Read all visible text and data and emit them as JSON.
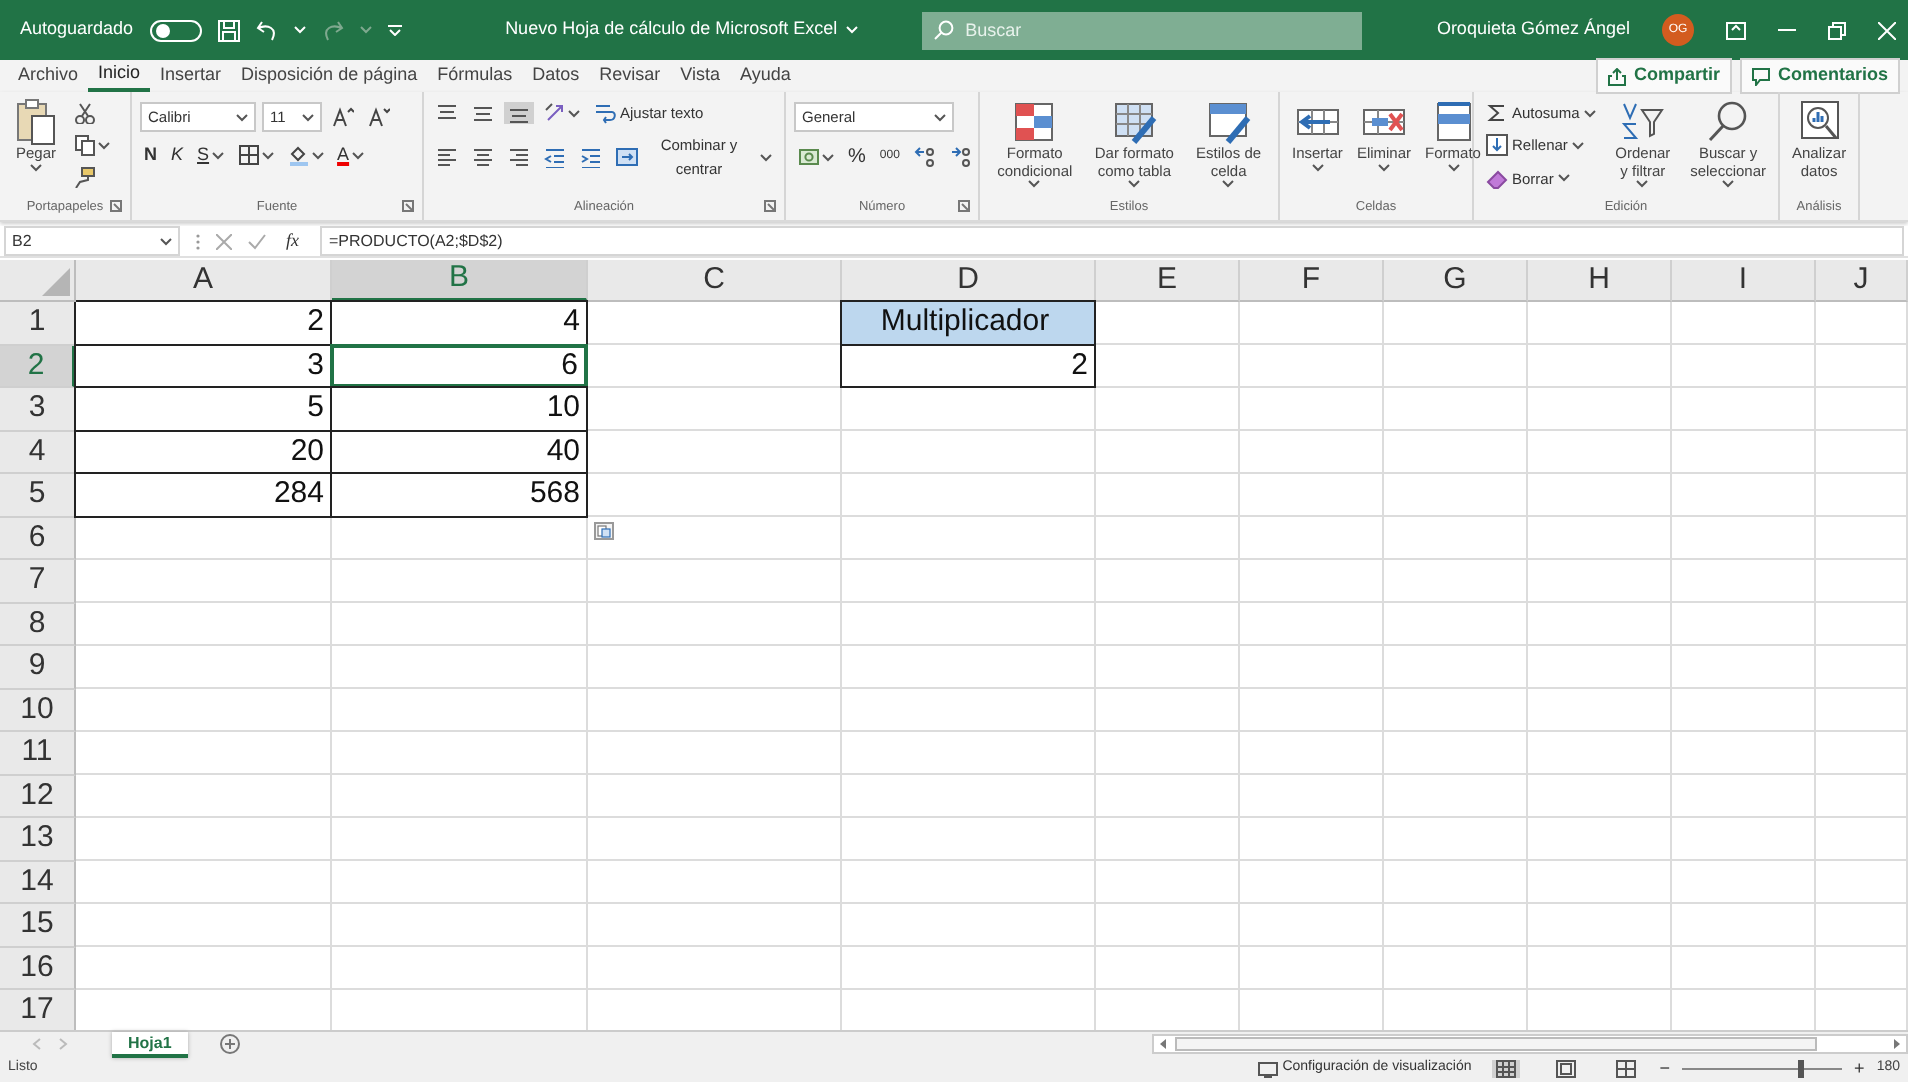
{
  "title_bar": {
    "autosave": {
      "label": "Autoguardado",
      "on": false
    },
    "document_title": "Nuevo Hoja de cálculo de Microsoft Excel",
    "search": {
      "placeholder": "Buscar"
    },
    "user_name": "Oroquieta Gómez Ángel",
    "avatar_initials": "OG"
  },
  "menu_tabs": [
    {
      "label": "Archivo",
      "selected": false
    },
    {
      "label": "Inicio",
      "selected": true
    },
    {
      "label": "Insertar",
      "selected": false
    },
    {
      "label": "Disposición de página",
      "selected": false
    },
    {
      "label": "Fórmulas",
      "selected": false
    },
    {
      "label": "Datos",
      "selected": false
    },
    {
      "label": "Revisar",
      "selected": false
    },
    {
      "label": "Vista",
      "selected": false
    },
    {
      "label": "Ayuda",
      "selected": false
    }
  ],
  "share_button": "Compartir",
  "comments_button": "Comentarios",
  "ribbon": [
    {
      "name": "Portapapeles",
      "launcher": true,
      "items": [
        {
          "kind": "large",
          "label": "Pegar",
          "dropdown": true
        },
        {
          "kind": "stack",
          "lines": [
            {
              "items": [
                {
                  "kind": "icon"
                }
              ]
            },
            {
              "items": [
                {
                  "kind": "icon",
                  "dropdown": true
                }
              ]
            },
            {
              "items": [
                {
                  "kind": "icon"
                }
              ]
            }
          ]
        }
      ]
    },
    {
      "name": "Fuente",
      "launcher": true,
      "items": [
        {
          "kind": "stack",
          "lines": [
            {
              "items": [
                {
                  "kind": "field",
                  "value": "Calibri",
                  "wide": true
                },
                {
                  "kind": "field",
                  "value": "11"
                },
                {
                  "kind": "icon"
                },
                {
                  "kind": "icon"
                }
              ]
            },
            {
              "items": [
                {
                  "kind": "bold",
                  "label": "N"
                },
                {
                  "kind": "italic",
                  "label": "K"
                },
                {
                  "kind": "underline",
                  "label": "S",
                  "dropdown": true
                },
                {
                  "kind": "icon",
                  "dropdown": true
                },
                {
                  "kind": "icon",
                  "dropdown": true
                },
                {
                  "kind": "fontcolor",
                  "label": "A",
                  "dropdown": true
                }
              ]
            }
          ]
        }
      ]
    },
    {
      "name": "Alineación",
      "launcher": true,
      "items": [
        {
          "kind": "stack",
          "lines": [
            {
              "items": [
                {
                  "kind": "icon",
                  "selected": false
                },
                {
                  "kind": "icon",
                  "selected": false
                },
                {
                  "kind": "icon",
                  "selected": true
                },
                {
                  "kind": "icon",
                  "dropdown": true
                },
                {
                  "kind": "button",
                  "label": "Ajustar texto"
                }
              ]
            },
            {
              "items": [
                {
                  "kind": "icon"
                },
                {
                  "kind": "icon"
                },
                {
                  "kind": "icon"
                },
                {
                  "kind": "icon"
                },
                {
                  "kind": "icon"
                },
                {
                  "kind": "button",
                  "label": "Combinar y centrar",
                  "dropdown": true
                }
              ]
            }
          ]
        }
      ]
    },
    {
      "name": "Número",
      "launcher": true,
      "items": [
        {
          "kind": "stack",
          "lines": [
            {
              "items": [
                {
                  "kind": "field",
                  "value": "General",
                  "wide": true
                }
              ]
            },
            {
              "items": [
                {
                  "kind": "icon",
                  "dropdown": true
                },
                {
                  "kind": "text",
                  "label": "%"
                },
                {
                  "kind": "text",
                  "label": "000"
                },
                {
                  "kind": "icon"
                },
                {
                  "kind": "icon"
                }
              ]
            }
          ]
        }
      ]
    },
    {
      "name": "Estilos",
      "launcher": false,
      "items": [
        {
          "kind": "large",
          "label": "Formato condicional",
          "dropdown": true
        },
        {
          "kind": "large",
          "label": "Dar formato como tabla",
          "dropdown": true
        },
        {
          "kind": "large",
          "label": "Estilos de celda",
          "dropdown": true
        }
      ]
    },
    {
      "name": "Celdas",
      "launcher": false,
      "items": [
        {
          "kind": "large",
          "label": "Insertar",
          "dropdown": true
        },
        {
          "kind": "large",
          "label": "Eliminar",
          "dropdown": true
        },
        {
          "kind": "large",
          "label": "Formato",
          "dropdown": true
        }
      ]
    },
    {
      "name": "Edición",
      "launcher": false,
      "items": [
        {
          "kind": "stack",
          "lines": [
            {
              "items": [
                {
                  "kind": "button",
                  "label": "Autosuma",
                  "dropdown": true
                }
              ]
            },
            {
              "items": [
                {
                  "kind": "button",
                  "label": "Rellenar",
                  "dropdown": true
                }
              ]
            },
            {
              "items": [
                {
                  "kind": "button",
                  "label": "Borrar",
                  "dropdown": true
                }
              ]
            }
          ]
        },
        {
          "kind": "large",
          "label": "Ordenar y filtrar",
          "dropdown": true
        },
        {
          "kind": "large",
          "label": "Buscar y seleccionar",
          "dropdown": true
        }
      ]
    },
    {
      "name": "Análisis",
      "launcher": false,
      "items": [
        {
          "kind": "large",
          "label": "Analizar datos"
        }
      ]
    }
  ],
  "formula_bar": {
    "name_box": "B2",
    "fx": "fx",
    "formula": "=PRODUCTO(A2;$D$2)"
  },
  "columns": [
    {
      "label": "A",
      "selected": false
    },
    {
      "label": "B",
      "selected": true
    },
    {
      "label": "C",
      "selected": false
    },
    {
      "label": "D",
      "selected": false
    },
    {
      "label": "E",
      "selected": false
    },
    {
      "label": "F",
      "selected": false
    },
    {
      "label": "G",
      "selected": false
    },
    {
      "label": "H",
      "selected": false
    },
    {
      "label": "I",
      "selected": false
    },
    {
      "label": "J",
      "selected": false
    }
  ],
  "rows": [
    {
      "label": "1",
      "selected": false,
      "cells": [
        "2",
        "4",
        null,
        {
          "value": "Multiplicador",
          "kind": "header"
        }
      ]
    },
    {
      "label": "2",
      "selected": true,
      "cells": [
        "3",
        {
          "value": "6",
          "selected": true
        },
        null,
        "2"
      ]
    },
    {
      "label": "3",
      "selected": false,
      "cells": [
        "5",
        "10"
      ]
    },
    {
      "label": "4",
      "selected": false,
      "cells": [
        "20",
        "40"
      ]
    },
    {
      "label": "5",
      "selected": false,
      "cells": [
        "284",
        "568"
      ]
    },
    {
      "label": "6",
      "selected": false,
      "cells": [],
      "paste_options": true
    },
    {
      "label": "7",
      "selected": false,
      "cells": []
    },
    {
      "label": "8",
      "selected": false,
      "cells": []
    },
    {
      "label": "9",
      "selected": false,
      "cells": []
    },
    {
      "label": "10",
      "selected": false,
      "cells": []
    },
    {
      "label": "11",
      "selected": false,
      "cells": []
    },
    {
      "label": "12",
      "selected": false,
      "cells": []
    },
    {
      "label": "13",
      "selected": false,
      "cells": []
    },
    {
      "label": "14",
      "selected": false,
      "cells": []
    },
    {
      "label": "15",
      "selected": false,
      "cells": []
    },
    {
      "label": "16",
      "selected": false,
      "cells": []
    },
    {
      "label": "17",
      "selected": false,
      "cells": []
    }
  ],
  "sheet_tabs": [
    {
      "label": "Hoja1",
      "selected": true
    }
  ],
  "status_bar": {
    "status": "Listo",
    "display_settings": "Configuración de visualización",
    "views": [
      {
        "selected": true
      },
      {
        "selected": false
      },
      {
        "selected": false
      }
    ],
    "zoom_out": "−",
    "zoom": {
      "level": 0.72
    },
    "zoom_in": "+",
    "zoom_value": "180"
  }
}
